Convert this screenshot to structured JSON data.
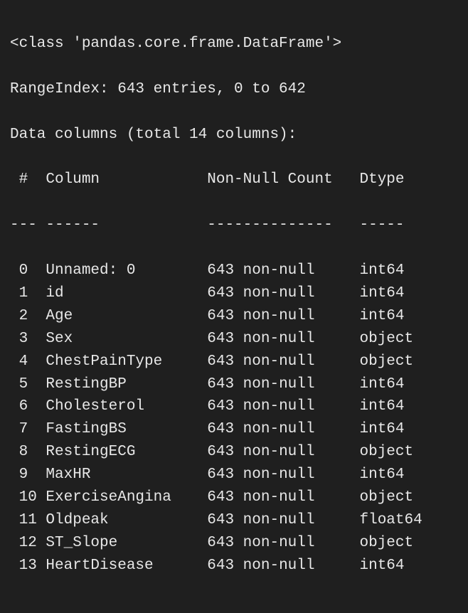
{
  "header": {
    "class_line": "<class 'pandas.core.frame.DataFrame'>",
    "index_line": "RangeIndex: 643 entries, 0 to 642",
    "cols_line": "Data columns (total 14 columns):"
  },
  "table_header": {
    "num": " #  ",
    "column": "Column        ",
    "count": "Non-Null Count",
    "dtype": "Dtype  "
  },
  "table_divider": {
    "num": "--- ",
    "column": "------        ",
    "count": "--------------",
    "dtype": "-----  "
  },
  "columns": [
    {
      "num": " 0  ",
      "name": "Unnamed: 0    ",
      "count": "643 non-null  ",
      "dtype": "int64  "
    },
    {
      "num": " 1  ",
      "name": "id            ",
      "count": "643 non-null  ",
      "dtype": "int64  "
    },
    {
      "num": " 2  ",
      "name": "Age           ",
      "count": "643 non-null  ",
      "dtype": "int64  "
    },
    {
      "num": " 3  ",
      "name": "Sex           ",
      "count": "643 non-null  ",
      "dtype": "object "
    },
    {
      "num": " 4  ",
      "name": "ChestPainType ",
      "count": "643 non-null  ",
      "dtype": "object "
    },
    {
      "num": " 5  ",
      "name": "RestingBP     ",
      "count": "643 non-null  ",
      "dtype": "int64  "
    },
    {
      "num": " 6  ",
      "name": "Cholesterol   ",
      "count": "643 non-null  ",
      "dtype": "int64  "
    },
    {
      "num": " 7  ",
      "name": "FastingBS     ",
      "count": "643 non-null  ",
      "dtype": "int64  "
    },
    {
      "num": " 8  ",
      "name": "RestingECG    ",
      "count": "643 non-null  ",
      "dtype": "object "
    },
    {
      "num": " 9  ",
      "name": "MaxHR         ",
      "count": "643 non-null  ",
      "dtype": "int64  "
    },
    {
      "num": " 10 ",
      "name": "ExerciseAngina",
      "count": "643 non-null  ",
      "dtype": "object "
    },
    {
      "num": " 11 ",
      "name": "Oldpeak       ",
      "count": "643 non-null  ",
      "dtype": "float64"
    },
    {
      "num": " 12 ",
      "name": "ST_Slope      ",
      "count": "643 non-null  ",
      "dtype": "object "
    },
    {
      "num": " 13 ",
      "name": "HeartDisease  ",
      "count": "643 non-null  ",
      "dtype": "int64  "
    }
  ]
}
